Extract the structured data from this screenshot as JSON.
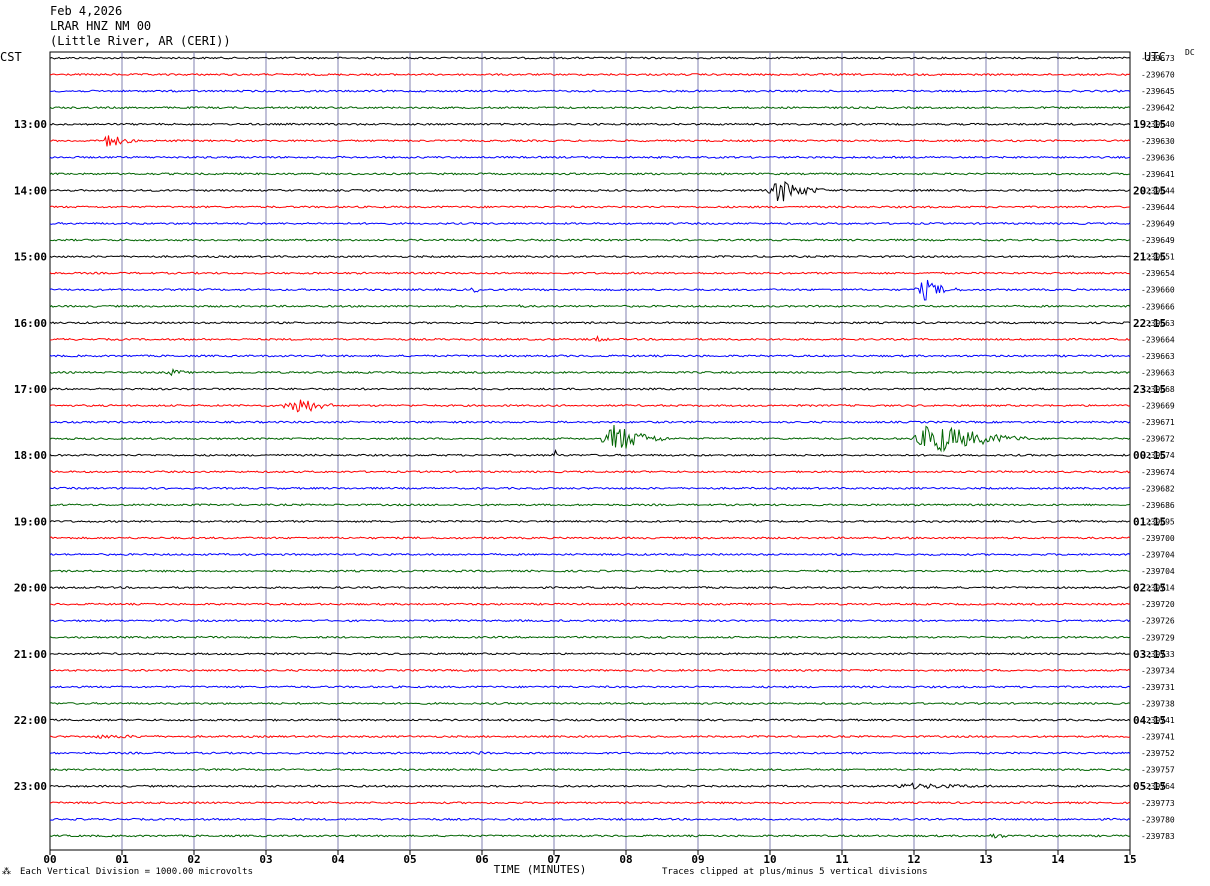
{
  "header": {
    "date": "Feb 4,2026",
    "station": "LRAR HNZ NM 00",
    "location": "(Little River, AR (CERI))"
  },
  "left_timezone": "CST",
  "right_timezone": "UTC",
  "dc_label": "DC",
  "footer": {
    "scale_note": "Each Vertical Division = 1000.00 microvolts",
    "clip_note": "Traces clipped at plus/minus 5 vertical divisions",
    "corner_mark": "⁂"
  },
  "colors": {
    "trace_cycle": [
      "#000000",
      "#ff0000",
      "#0000ff",
      "#006400"
    ],
    "grid": "#8080b0"
  },
  "chart_data": {
    "type": "line",
    "title": "LRAR HNZ NM 00",
    "xlabel": "TIME (MINUTES)",
    "ylabel": "",
    "x_ticks": [
      "00",
      "01",
      "02",
      "03",
      "04",
      "05",
      "06",
      "07",
      "08",
      "09",
      "10",
      "11",
      "12",
      "13",
      "14",
      "15"
    ],
    "xlim": [
      0,
      15
    ],
    "left_hour_labels": [
      "13:00",
      "14:00",
      "15:00",
      "16:00",
      "17:00",
      "18:00",
      "19:00",
      "20:00",
      "21:00",
      "22:00",
      "23:00"
    ],
    "right_hour_labels": [
      "19:15",
      "20:15",
      "21:15",
      "22:15",
      "23:15",
      "00:15",
      "01:15",
      "02:15",
      "03:15",
      "04:15",
      "05:15"
    ],
    "first_labeled_row": 4,
    "rows_per_hour": 4,
    "dc_offsets": [
      "-239673",
      "-239670",
      "-239645",
      "-239642",
      "-239640",
      "-239630",
      "-239636",
      "-239641",
      "-239644",
      "-239644",
      "-239649",
      "-239649",
      "-239651",
      "-239654",
      "-239660",
      "-239666",
      "-239663",
      "-239664",
      "-239663",
      "-239663",
      "-239668",
      "-239669",
      "-239671",
      "-239672",
      "-239674",
      "-239674",
      "-239682",
      "-239686",
      "-239695",
      "-239700",
      "-239704",
      "-239704",
      "-239714",
      "-239720",
      "-239726",
      "-239729",
      "-239733",
      "-239734",
      "-239731",
      "-239738",
      "-239741",
      "-239741",
      "-239752",
      "-239757",
      "-239764",
      "-239773",
      "-239780",
      "-239783"
    ],
    "events": [
      {
        "row": 5,
        "minute": 0.7,
        "amplitude": 8,
        "duration": 0.6
      },
      {
        "row": 8,
        "minute": 10.0,
        "amplitude": 14,
        "duration": 0.8
      },
      {
        "row": 14,
        "minute": 12.05,
        "amplitude": 12,
        "duration": 0.6
      },
      {
        "row": 14,
        "minute": 5.8,
        "amplitude": 3,
        "duration": 0.5
      },
      {
        "row": 15,
        "minute": 6.4,
        "amplitude": 2,
        "duration": 0.6
      },
      {
        "row": 17,
        "minute": 7.5,
        "amplitude": 4,
        "duration": 0.4
      },
      {
        "row": 19,
        "minute": 1.6,
        "amplitude": 4,
        "duration": 0.5
      },
      {
        "row": 21,
        "minute": 3.3,
        "amplitude": 12,
        "duration": 0.7
      },
      {
        "row": 23,
        "minute": 7.7,
        "amplitude": 17,
        "duration": 0.9
      },
      {
        "row": 23,
        "minute": 12.0,
        "amplitude": 18,
        "duration": 1.6
      },
      {
        "row": 24,
        "minute": 7.0,
        "amplitude": 7,
        "duration": 0.12
      },
      {
        "row": 41,
        "minute": 0.3,
        "amplitude": 2,
        "duration": 3.0
      },
      {
        "row": 42,
        "minute": 5.8,
        "amplitude": 2,
        "duration": 0.8
      },
      {
        "row": 44,
        "minute": 11.5,
        "amplitude": 3,
        "duration": 3.0
      },
      {
        "row": 47,
        "minute": 13.0,
        "amplitude": 3,
        "duration": 0.6
      }
    ]
  }
}
